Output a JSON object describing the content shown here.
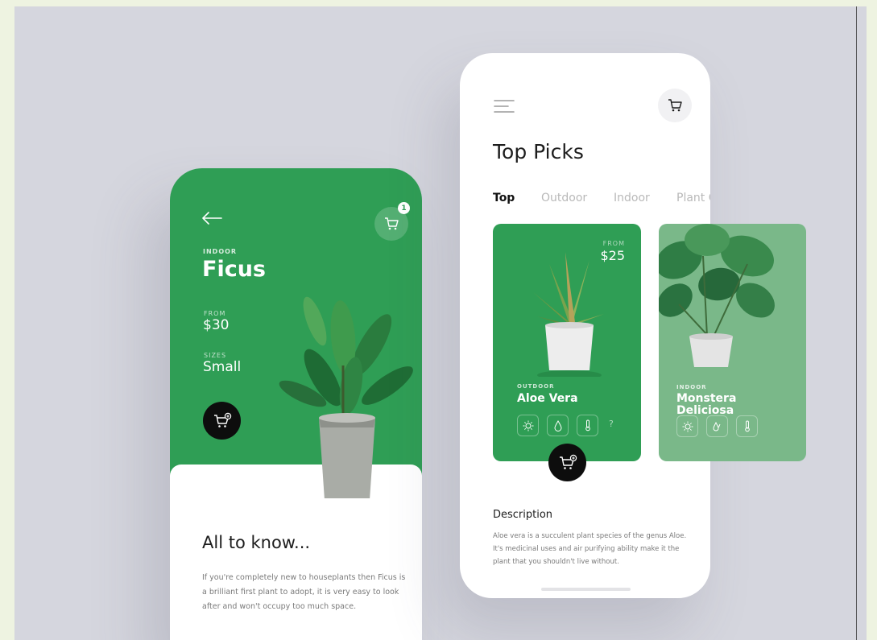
{
  "detail_screen": {
    "cart_badge": "1",
    "category": "INDOOR",
    "title": "Ficus",
    "price_label": "FROM",
    "price": "$30",
    "size_label": "SIZES",
    "size": "Small",
    "section_title": "All to know...",
    "section_text": "If you're completely new to houseplants then Ficus is a brilliant first plant to adopt, it is very easy to look after and won't occupy too much space."
  },
  "list_screen": {
    "title": "Top Picks",
    "tabs": [
      {
        "label": "Top"
      },
      {
        "label": "Outdoor"
      },
      {
        "label": "Indoor"
      },
      {
        "label": "Plant C"
      }
    ],
    "cards": [
      {
        "price_label": "FROM",
        "price": "$25",
        "category": "OUTDOOR",
        "name": "Aloe Vera",
        "icons": [
          "sun-icon",
          "water-drop-icon",
          "thermometer-icon"
        ],
        "help": "?"
      },
      {
        "category": "INDOOR",
        "name": "Monstera Deliciosa",
        "icons": [
          "sun-icon",
          "water-drops-icon",
          "thermometer-icon"
        ]
      }
    ],
    "description_title": "Description",
    "description_text": "Aloe vera is a succulent plant species of the genus Aloe. It's medicinal uses and air purifying ability make it the plant that you shouldn't live without."
  },
  "colors": {
    "brand_green": "#2f9e55",
    "faded_green": "#7ab889",
    "stage_bg": "#d5d6de",
    "frame_bg": "#eef3e1",
    "dark_button": "#0d0d0d"
  }
}
